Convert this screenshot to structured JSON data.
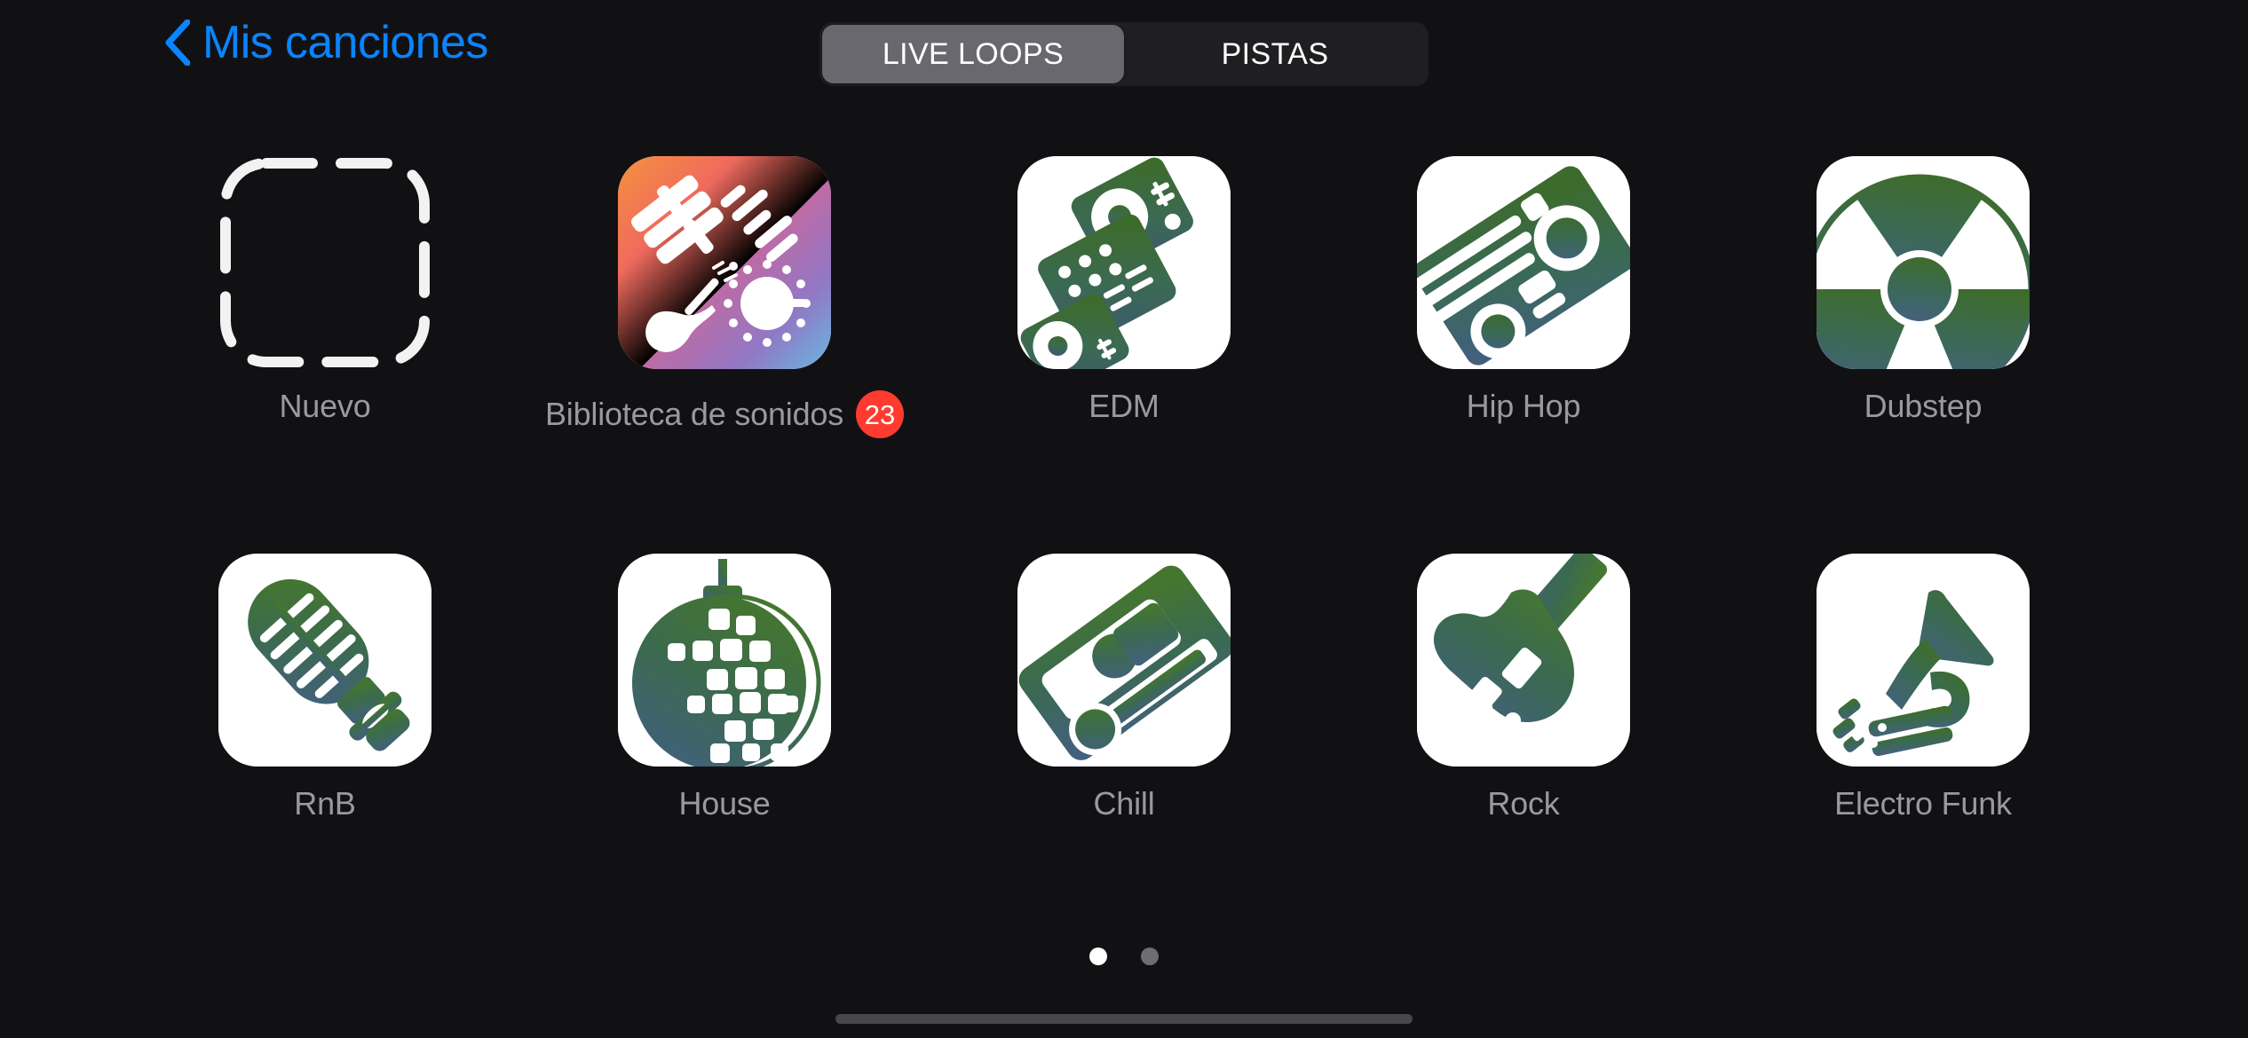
{
  "app": {
    "background_color": "#111114",
    "accent_color": "#0a84ff",
    "badge_color": "#ff3b30"
  },
  "navbar": {
    "back_icon": "chevron-left-icon",
    "back_label": "Mis canciones"
  },
  "segmented_control": {
    "selected_index": 0,
    "segments": [
      {
        "label": "LIVE LOOPS",
        "active": true
      },
      {
        "label": "PISTAS",
        "active": false
      }
    ]
  },
  "grid": {
    "rows": [
      [
        {
          "label": "Nuevo",
          "icon": "new-project-dashed-icon",
          "badge": null
        },
        {
          "label": "Biblioteca de sonidos",
          "icon": "sound-library-icon",
          "badge": "23"
        },
        {
          "label": "EDM",
          "icon": "edm-turntables-icon",
          "badge": null
        },
        {
          "label": "Hip Hop",
          "icon": "hip-hop-boombox-icon",
          "badge": null
        },
        {
          "label": "Dubstep",
          "icon": "dubstep-speaker-cone-icon",
          "badge": null
        }
      ],
      [
        {
          "label": "RnB",
          "icon": "rnb-microphone-icon",
          "badge": null
        },
        {
          "label": "House",
          "icon": "house-disco-ball-icon",
          "badge": null
        },
        {
          "label": "Chill",
          "icon": "chill-cassette-icon",
          "badge": null
        },
        {
          "label": "Rock",
          "icon": "rock-guitar-icon",
          "badge": null
        },
        {
          "label": "Electro Funk",
          "icon": "electro-funk-trumpet-icon",
          "badge": null
        }
      ]
    ]
  },
  "pagination": {
    "total_pages": 2,
    "current_page": 1
  },
  "home_indicator": {
    "name": "home-indicator"
  }
}
